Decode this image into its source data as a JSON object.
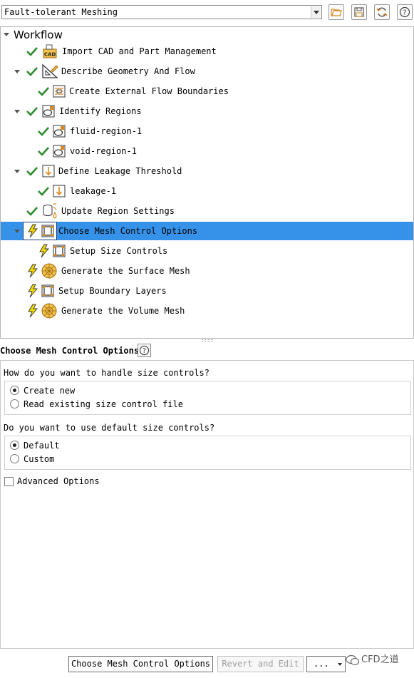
{
  "toolbar": {
    "workflow_type": "Fault-tolerant Meshing",
    "icons": [
      "folder-open-icon",
      "save-icon",
      "refresh-icon",
      "help-icon"
    ]
  },
  "tree": {
    "root_label": "Workflow",
    "items": [
      {
        "label": "Import CAD and Part Management",
        "status": "done",
        "icon": "cad-import-icon"
      },
      {
        "label": "Describe Geometry And Flow",
        "status": "done",
        "icon": "geometry-icon"
      },
      {
        "label": "Create External Flow Boundaries",
        "status": "done",
        "icon": "boundaries-icon"
      },
      {
        "label": "Identify Regions",
        "status": "done",
        "icon": "region-icon"
      },
      {
        "label": "fluid-region-1",
        "status": "done",
        "icon": "region-icon"
      },
      {
        "label": "void-region-1",
        "status": "done",
        "icon": "region-icon"
      },
      {
        "label": "Define Leakage Threshold",
        "status": "done",
        "icon": "leakage-icon"
      },
      {
        "label": "leakage-1",
        "status": "done",
        "icon": "leakage-icon"
      },
      {
        "label": "Update Region Settings",
        "status": "done",
        "icon": "region-settings-icon"
      },
      {
        "label": "Choose Mesh Control Options",
        "status": "pending",
        "icon": "mesh-control-icon",
        "selected": true
      },
      {
        "label": "Setup Size Controls",
        "status": "pending",
        "icon": "mesh-control-icon"
      },
      {
        "label": "Generate the Surface Mesh",
        "status": "pending",
        "icon": "surface-mesh-icon"
      },
      {
        "label": "Setup Boundary Layers",
        "status": "pending",
        "icon": "mesh-control-icon"
      },
      {
        "label": "Generate the Volume Mesh",
        "status": "pending",
        "icon": "volume-mesh-icon"
      }
    ]
  },
  "options": {
    "title": "Choose Mesh Control Options",
    "q1": "How do you want to handle size controls?",
    "q1_options": [
      "Create new",
      "Read existing size control file"
    ],
    "q1_selected": "Create new",
    "q2": "Do you want to use default size controls?",
    "q2_options": [
      "Default",
      "Custom"
    ],
    "q2_selected": "Default",
    "advanced_label": "Advanced Options",
    "advanced_checked": false
  },
  "buttons": {
    "primary": "Choose Mesh Control Options",
    "revert": "Revert and Edit",
    "more": "..."
  },
  "watermark": "CFD之道",
  "colors": {
    "selection": "#3592e8",
    "check": "#2e8b2e",
    "bolt": "#f0d800",
    "icon_accent": "#d9891f"
  }
}
